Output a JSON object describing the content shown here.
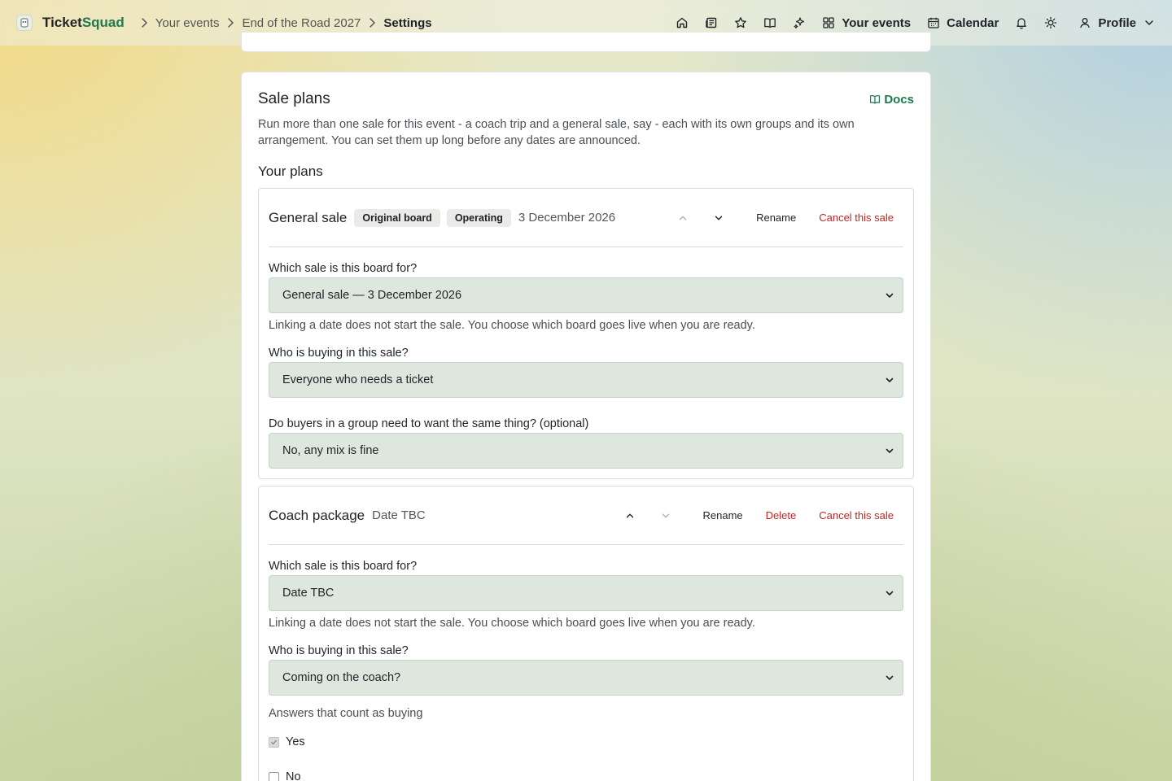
{
  "brand": {
    "name_part1": "Ticket",
    "name_part2": "Squad"
  },
  "breadcrumb": [
    "Your events",
    "End of the Road 2027",
    "Settings"
  ],
  "nav": {
    "icons": [
      "home-icon",
      "newspaper-icon",
      "star-icon",
      "book-icon",
      "sparkles-icon"
    ],
    "your_events": "Your events",
    "calendar": "Calendar",
    "profile": "Profile"
  },
  "card": {
    "title": "Sale plans",
    "docs": "Docs",
    "description": "Run more than one sale for this event - a coach trip and a general sale, say - each with its own groups and its own arrangement. You can set them up long before any dates are announced.",
    "section_title": "Your plans"
  },
  "plans": [
    {
      "name": "General sale",
      "badges": [
        "Original board",
        "Operating"
      ],
      "date": "3 December 2026",
      "actions": {
        "rename": "Rename",
        "cancel": "Cancel this sale"
      },
      "fields": {
        "board_label": "Which sale is this board for?",
        "board_value": "General sale — 3 December 2026",
        "board_help": "Linking a date does not start the sale. You choose which board goes live when you are ready.",
        "buying_label": "Who is buying in this sale?",
        "buying_value": "Everyone who needs a ticket",
        "same_label": "Do buyers in a group need to want the same thing? (optional)",
        "same_value": "No, any mix is fine"
      }
    },
    {
      "name": "Coach package",
      "date": "Date TBC",
      "actions": {
        "rename": "Rename",
        "delete": "Delete",
        "cancel": "Cancel this sale"
      },
      "fields": {
        "board_label": "Which sale is this board for?",
        "board_value": "Date TBC",
        "board_help": "Linking a date does not start the sale. You choose which board goes live when you are ready.",
        "buying_label": "Who is buying in this sale?",
        "buying_value": "Coming on the coach?",
        "answers_label": "Answers that count as buying",
        "answers": [
          {
            "label": "Yes",
            "checked": true
          },
          {
            "label": "No",
            "checked": false
          }
        ]
      }
    }
  ]
}
